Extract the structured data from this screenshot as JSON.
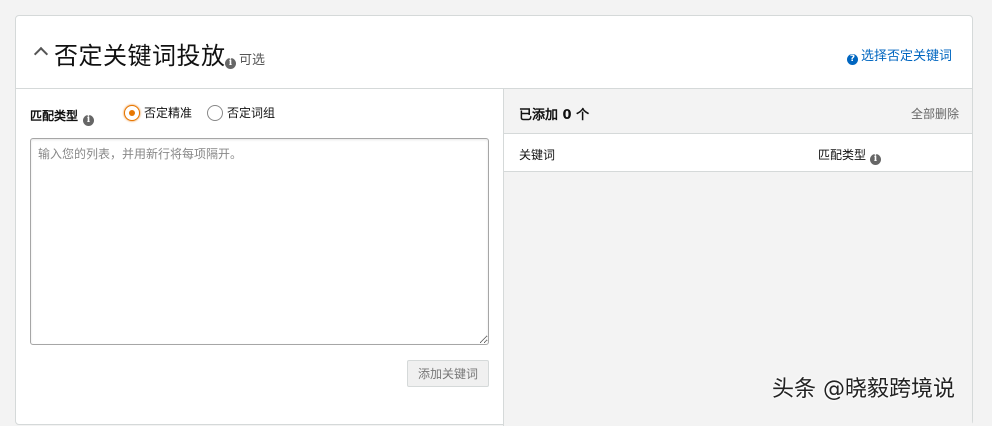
{
  "header": {
    "title": "否定关键词投放",
    "optional_label": "可选",
    "help_link": "选择否定关键词"
  },
  "left": {
    "match_type_label": "匹配类型",
    "radio_options": [
      {
        "label": "否定精准",
        "checked": true
      },
      {
        "label": "否定词组",
        "checked": false
      }
    ],
    "textarea_placeholder": "输入您的列表，并用新行将每项隔开。",
    "add_button": "添加关键词"
  },
  "right": {
    "added_count": "已添加 0 个",
    "delete_all": "全部删除",
    "columns": [
      "关键词",
      "匹配类型"
    ]
  },
  "watermark": "头条 @晓毅跨境说",
  "colors": {
    "accent": "#e77600",
    "link": "#0066c0"
  }
}
